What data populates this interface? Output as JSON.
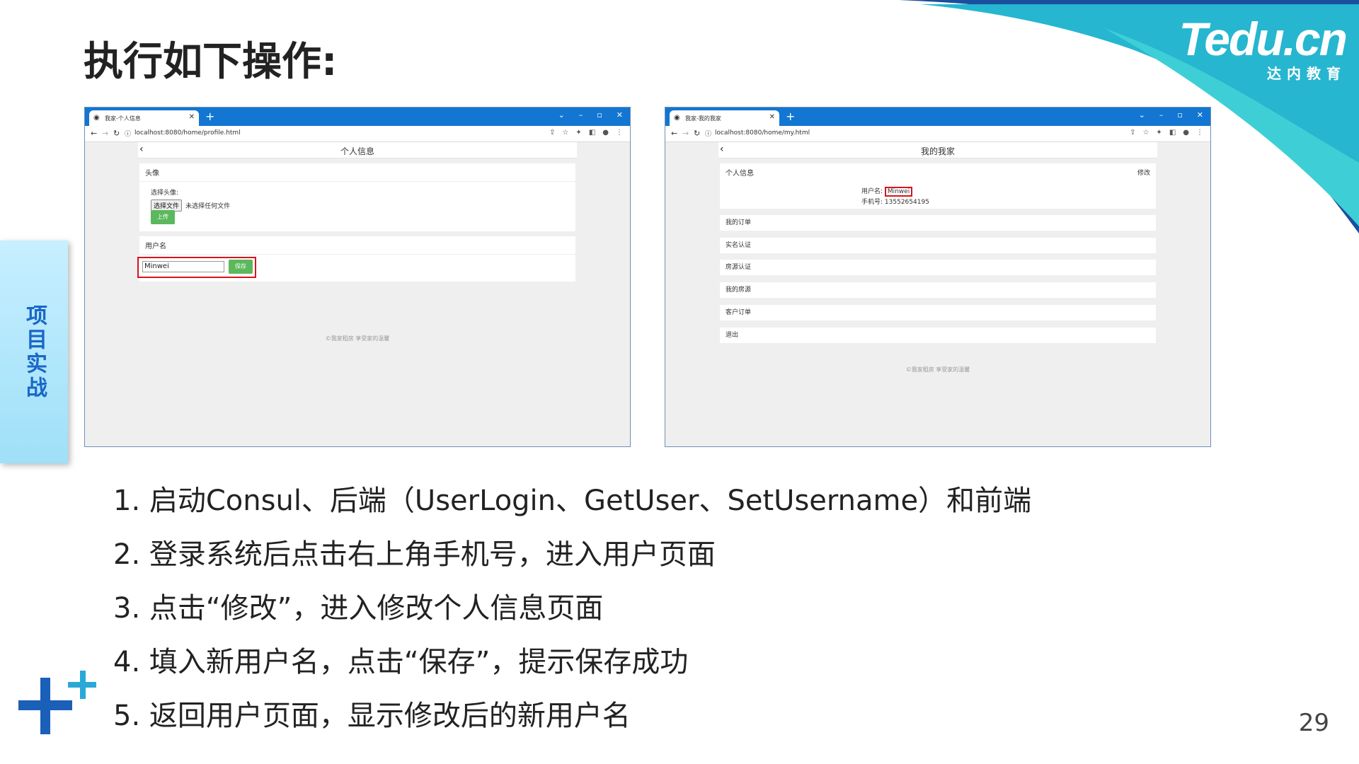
{
  "slide": {
    "title": "执行如下操作:",
    "side_tab": "项目实战",
    "page_number": "29",
    "logo_main": "Tedu.cn",
    "logo_sub": "达内教育",
    "steps": [
      "1. 启动Consul、后端（UserLogin、GetUser、SetUsername）和前端",
      "2. 登录系统后点击右上角手机号，进入用户页面",
      "3. 点击“修改”，进入修改个人信息页面",
      "4. 填入新用户名，点击“保存”，提示保存成功",
      "5. 返回用户页面，显示修改后的新用户名"
    ]
  },
  "left_browser": {
    "tab_title": "我家-个人信息",
    "url": "localhost:8080/home/profile.html",
    "page_title": "个人信息",
    "avatar_section": {
      "heading": "头像",
      "choose_label": "选择头像:",
      "file_button": "选择文件",
      "file_status": "未选择任何文件",
      "upload_button": "上传"
    },
    "username_section": {
      "heading": "用户名",
      "input_value": "Minwei",
      "save_button": "保存"
    },
    "footer": "©我家租房  享受家的温馨"
  },
  "right_browser": {
    "tab_title": "我家-我的我家",
    "url": "localhost:8080/home/my.html",
    "page_title": "我的我家",
    "profile_card": {
      "heading": "个人信息",
      "edit_link": "修改",
      "username_label": "用户名:",
      "username_value": "Minwei",
      "phone_label": "手机号:",
      "phone_value": "13552654195"
    },
    "menu_items": [
      "我的订单",
      "实名认证",
      "房源认证",
      "我的房源",
      "客户订单",
      "退出"
    ],
    "footer": "©我家租房  享受家的温馨"
  },
  "colors": {
    "browser_chrome": "#1276d2",
    "accent_red": "#d9141e",
    "button_green": "#5cb85c",
    "title_text": "#222222",
    "side_tab_text": "#1967c8"
  }
}
